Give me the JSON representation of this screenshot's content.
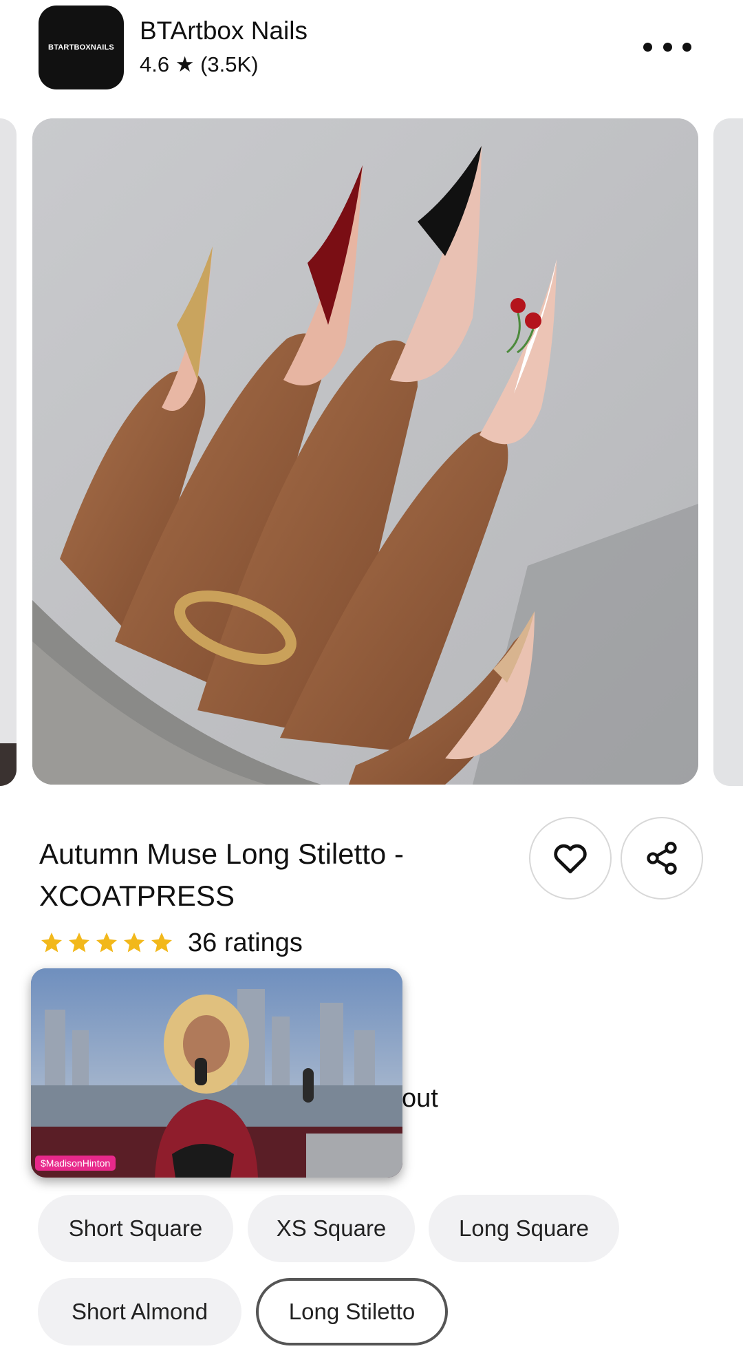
{
  "shop": {
    "logo_text": "BTARTBOXNAILS",
    "name": "BTArtbox Nails",
    "rating": "4.6 ★ (3.5K)"
  },
  "header": {
    "more_icon": "more-horizontal-icon"
  },
  "product": {
    "title_line1": "Autumn Muse Long Stiletto -",
    "title_line2": "XCOATPRESS",
    "stars": 5,
    "ratings_label": "36 ratings",
    "partial_text": "out"
  },
  "actions": {
    "favorite_icon": "heart-icon",
    "share_icon": "share-icon"
  },
  "live_stream": {
    "host": "$MadisonHinton"
  },
  "variants": {
    "options": [
      "Short Square",
      "XS Square",
      "Long Square",
      "Short Almond",
      "Long Stiletto"
    ],
    "selected": "Long Stiletto"
  },
  "colors": {
    "star": "#f2b81b",
    "host_tag": "#e8298b",
    "selected_border": "#555555",
    "chip_bg": "#f1f1f3"
  }
}
